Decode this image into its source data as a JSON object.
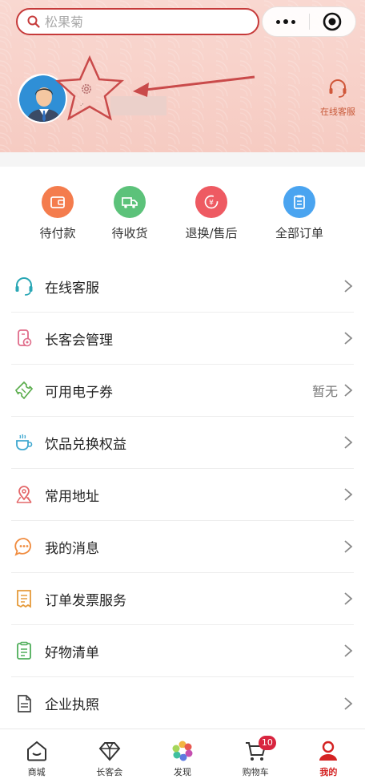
{
  "header": {
    "search_placeholder": "松果菊",
    "online_service_label": "在线客服",
    "username_hint": "·’"
  },
  "orders": [
    {
      "label": "待付款",
      "icon": "wallet-icon",
      "color": "#f47c4d"
    },
    {
      "label": "待收货",
      "icon": "truck-icon",
      "color": "#5cc27a"
    },
    {
      "label": "退换/售后",
      "icon": "refund-icon",
      "color": "#ee5a62"
    },
    {
      "label": "全部订单",
      "icon": "clipboard-icon",
      "color": "#4aa4f0"
    }
  ],
  "menu": [
    {
      "label": "在线客服",
      "icon": "headset-icon",
      "value": ""
    },
    {
      "label": "长客会管理",
      "icon": "membership-icon",
      "value": ""
    },
    {
      "label": "可用电子券",
      "icon": "ticket-icon",
      "value": "暂无"
    },
    {
      "label": "饮品兑换权益",
      "icon": "cup-icon",
      "value": ""
    },
    {
      "label": "常用地址",
      "icon": "location-icon",
      "value": ""
    },
    {
      "label": "我的消息",
      "icon": "message-icon",
      "value": ""
    },
    {
      "label": "订单发票服务",
      "icon": "invoice-icon",
      "value": ""
    },
    {
      "label": "好物清单",
      "icon": "checklist-icon",
      "value": ""
    },
    {
      "label": "企业执照",
      "icon": "document-icon",
      "value": ""
    }
  ],
  "tabs": [
    {
      "label": "商城",
      "icon": "store-icon"
    },
    {
      "label": "长客会",
      "icon": "diamond-icon"
    },
    {
      "label": "发现",
      "icon": "discover-icon"
    },
    {
      "label": "购物车",
      "icon": "cart-icon",
      "badge": "10"
    },
    {
      "label": "我的",
      "icon": "profile-icon",
      "active": true
    }
  ],
  "colors": {
    "accent": "#c63a3a",
    "header_bg": "#f8d3cc",
    "badge": "#d8253f",
    "active_tab": "#d42222"
  }
}
